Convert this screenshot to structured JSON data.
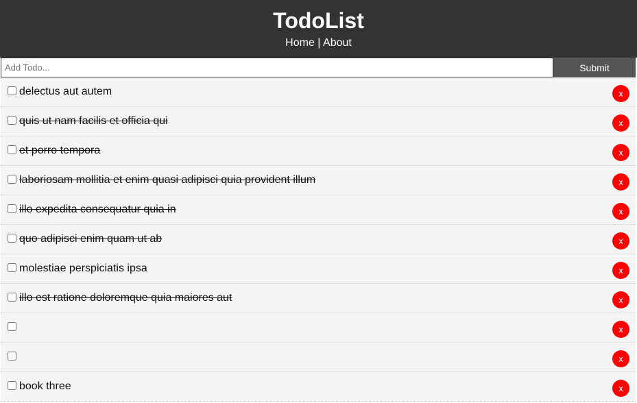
{
  "header": {
    "title": "TodoList",
    "nav": {
      "home": "Home",
      "separator": " | ",
      "about": "About"
    }
  },
  "form": {
    "placeholder": "Add Todo...",
    "value": "",
    "submit_label": "Submit"
  },
  "todos": [
    {
      "title": "delectus aut autem",
      "completed": false,
      "delete_label": "x"
    },
    {
      "title": "quis ut nam facilis et officia qui",
      "completed": true,
      "delete_label": "x"
    },
    {
      "title": "et porro tempora",
      "completed": true,
      "delete_label": "x"
    },
    {
      "title": "laboriosam mollitia et enim quasi adipisci quia provident illum",
      "completed": true,
      "delete_label": "x"
    },
    {
      "title": "illo expedita consequatur quia in",
      "completed": true,
      "delete_label": "x"
    },
    {
      "title": "quo adipisci enim quam ut ab",
      "completed": true,
      "delete_label": "x"
    },
    {
      "title": "molestiae perspiciatis ipsa",
      "completed": false,
      "delete_label": "x"
    },
    {
      "title": "illo est ratione doloremque quia maiores aut",
      "completed": true,
      "delete_label": "x"
    },
    {
      "title": "",
      "completed": false,
      "delete_label": "x"
    },
    {
      "title": "",
      "completed": false,
      "delete_label": "x"
    },
    {
      "title": "book three",
      "completed": false,
      "delete_label": "x"
    }
  ],
  "colors": {
    "header_bg": "#333333",
    "submit_bg": "#555555",
    "delete_bg": "#ff0000",
    "item_bg": "#f4f4f4"
  }
}
